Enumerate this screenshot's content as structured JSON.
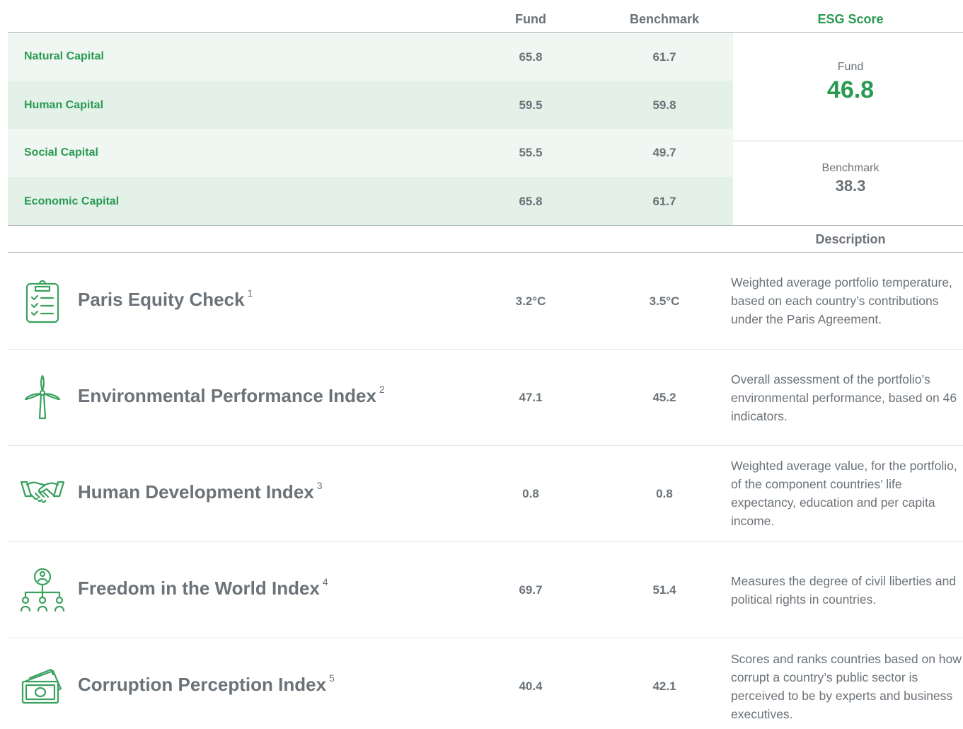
{
  "header": {
    "fund": "Fund",
    "benchmark": "Benchmark",
    "esg_score": "ESG Score",
    "description": "Description"
  },
  "capitals": [
    {
      "label": "Natural Capital",
      "fund": "65.8",
      "benchmark": "61.7"
    },
    {
      "label": "Human Capital",
      "fund": "59.5",
      "benchmark": "59.8"
    },
    {
      "label": "Social Capital",
      "fund": "55.5",
      "benchmark": "49.7"
    },
    {
      "label": "Economic Capital",
      "fund": "65.8",
      "benchmark": "61.7"
    }
  ],
  "esg": {
    "fund_label": "Fund",
    "fund_value": "46.8",
    "benchmark_label": "Benchmark",
    "benchmark_value": "38.3"
  },
  "indicators": [
    {
      "icon": "clipboard-checklist-icon",
      "name": "Paris Equity Check",
      "note": "1",
      "fund": "3.2°C",
      "benchmark": "3.5°C",
      "description": "Weighted average portfolio temperature, based on each country’s contributions under the Paris Agreement."
    },
    {
      "icon": "wind-turbine-icon",
      "name": "Environmental Performance Index",
      "note": "2",
      "fund": "47.1",
      "benchmark": "45.2",
      "description": "Overall assessment of the portfolio’s environmental performance, based on 46 indicators."
    },
    {
      "icon": "handshake-icon",
      "name": "Human Development Index",
      "note": "3",
      "fund": "0.8",
      "benchmark": "0.8",
      "description": "Weighted average value, for the portfolio, of the component countries’ life expectancy, education and per capita income."
    },
    {
      "icon": "people-hierarchy-icon",
      "name": "Freedom in the World Index",
      "note": "4",
      "fund": "69.7",
      "benchmark": "51.4",
      "description": "Measures the degree of civil liberties and political rights in countries."
    },
    {
      "icon": "banknotes-icon",
      "name": "Corruption Perception Index",
      "note": "5",
      "fund": "40.4",
      "benchmark": "42.1",
      "description": "Scores and ranks countries based on how corrupt a country’s public sector is perceived to be by experts and business executives."
    }
  ],
  "colors": {
    "accent_green": "#2a9a52",
    "text_gray": "#6b7278",
    "band_light": "#f0f7f3",
    "band_dark": "#e3f1e9",
    "icon_green": "#3aa15f"
  }
}
